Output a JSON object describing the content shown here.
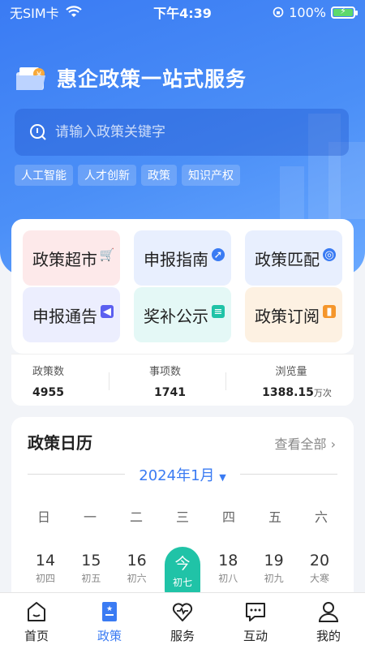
{
  "status": {
    "carrier": "无SIM卡",
    "time": "下午4:39",
    "battery": "100%"
  },
  "header": {
    "title": "惠企政策一站式服务"
  },
  "search": {
    "placeholder": "请输入政策关键字"
  },
  "chips": [
    "人工智能",
    "人才创新",
    "政策",
    "知识产权"
  ],
  "menu": {
    "items": [
      {
        "label": "政策超市",
        "icon": "cart-icon",
        "bg": "#fde9ea",
        "color": "#f0475a"
      },
      {
        "label": "申报指南",
        "icon": "compass-icon",
        "bg": "#e8effe",
        "color": "#3a7bf3"
      },
      {
        "label": "政策匹配",
        "icon": "target-icon",
        "bg": "#e8effe",
        "color": "#3a7bf3"
      },
      {
        "label": "申报通告",
        "icon": "megaphone-icon",
        "bg": "#eceefe",
        "color": "#5b5ff0"
      },
      {
        "label": "奖补公示",
        "icon": "ticket-icon",
        "bg": "#e4f8f6",
        "color": "#20c3a7"
      },
      {
        "label": "政策订阅",
        "icon": "bookmark-icon",
        "bg": "#fdf1e2",
        "color": "#f5962b"
      }
    ]
  },
  "stats": [
    {
      "label": "政策数",
      "value": "4955",
      "unit": ""
    },
    {
      "label": "事项数",
      "value": "1741",
      "unit": ""
    },
    {
      "label": "浏览量",
      "value": "1388.15",
      "unit": "万次"
    }
  ],
  "calendar": {
    "title": "政策日历",
    "view_all": "查看全部",
    "month": "2024年1月",
    "weekdays": [
      "日",
      "一",
      "二",
      "三",
      "四",
      "五",
      "六"
    ],
    "days": [
      {
        "num": "14",
        "lunar": "初四"
      },
      {
        "num": "15",
        "lunar": "初五"
      },
      {
        "num": "16",
        "lunar": "初六"
      },
      {
        "num": "今",
        "lunar": "初七",
        "today": true
      },
      {
        "num": "18",
        "lunar": "初八"
      },
      {
        "num": "19",
        "lunar": "初九"
      },
      {
        "num": "20",
        "lunar": "大寒"
      }
    ]
  },
  "tabs": [
    {
      "label": "首页",
      "icon": "home-icon"
    },
    {
      "label": "政策",
      "icon": "policy-icon",
      "active": true
    },
    {
      "label": "服务",
      "icon": "heart-icon"
    },
    {
      "label": "互动",
      "icon": "chat-icon"
    },
    {
      "label": "我的",
      "icon": "user-icon"
    }
  ]
}
